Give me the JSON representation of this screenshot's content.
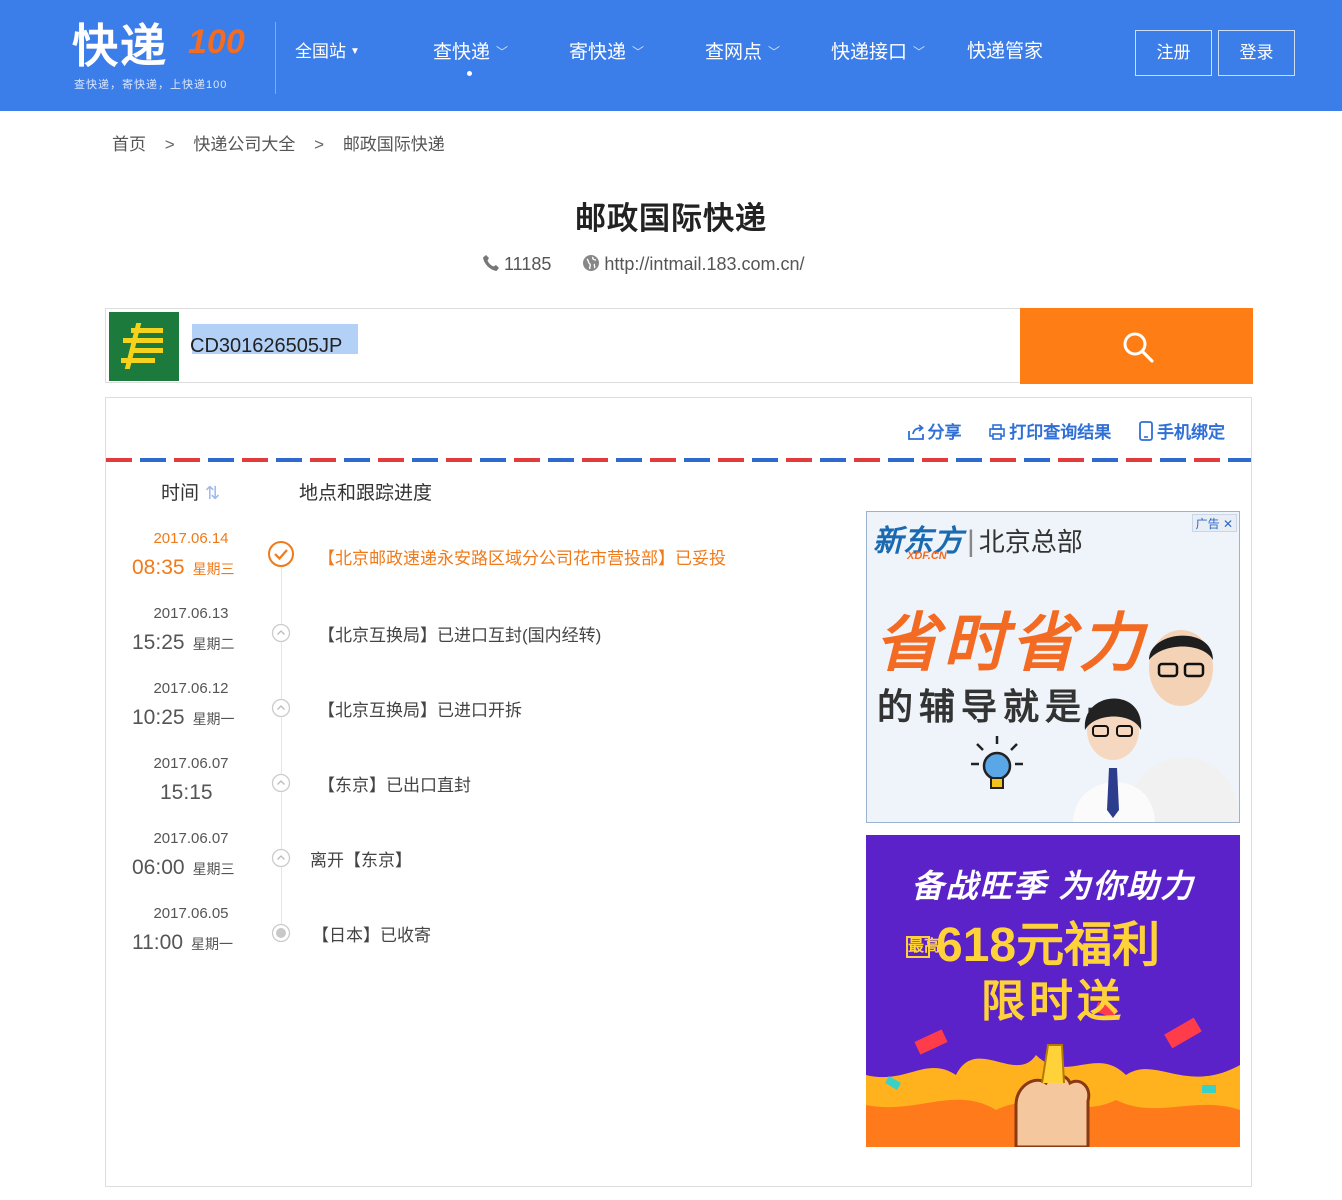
{
  "header": {
    "logo_text": "快递",
    "logo_mark": "100",
    "slogan": "查快递，寄快递，上快递100",
    "region": "全国站",
    "nav": [
      {
        "label": "查快递",
        "has_menu": true,
        "active": true
      },
      {
        "label": "寄快递",
        "has_menu": true,
        "active": false
      },
      {
        "label": "查网点",
        "has_menu": true,
        "active": false
      },
      {
        "label": "快递接口",
        "has_menu": true,
        "active": false
      },
      {
        "label": "快递管家",
        "has_menu": false,
        "active": false
      }
    ],
    "register": "注册",
    "login": "登录"
  },
  "breadcrumb": [
    "首页",
    "快递公司大全",
    "邮政国际快递"
  ],
  "breadcrumb_sep": ">",
  "company": {
    "name": "邮政国际快递",
    "phone": "11185",
    "website": "http://intmail.183.com.cn/"
  },
  "search": {
    "tracking_number": "CD301626505JP"
  },
  "actions": {
    "share": "分享",
    "print": "打印查询结果",
    "bind_phone": "手机绑定"
  },
  "columns": {
    "time": "时间",
    "progress": "地点和跟踪进度"
  },
  "events": [
    {
      "date": "2017.06.14",
      "time": "08:35",
      "weekday": "星期三",
      "desc": "【北京邮政速递永安路区域分公司花市营投部】已妥投"
    },
    {
      "date": "2017.06.13",
      "time": "15:25",
      "weekday": "星期二",
      "desc": "【北京互换局】已进口互封(国内经转)"
    },
    {
      "date": "2017.06.12",
      "time": "10:25",
      "weekday": "星期一",
      "desc": "【北京互换局】已进口开拆"
    },
    {
      "date": "2017.06.07",
      "time": "15:15",
      "weekday": "",
      "desc": "【东京】已出口直封"
    },
    {
      "date": "2017.06.07",
      "time": "06:00",
      "weekday": "星期三",
      "desc": "离开【东京】"
    },
    {
      "date": "2017.06.05",
      "time": "11:00",
      "weekday": "星期一",
      "desc": "【日本】已收寄"
    }
  ],
  "ads": {
    "badge": "广告",
    "ad1": {
      "brand": "新东方",
      "brand_sub": "XDF.CN",
      "location": "北京总部",
      "slogan": "省时省力",
      "sub": "的辅导就是-"
    },
    "ad2": {
      "line1": "备战旺季 为你助力",
      "tag": "最高",
      "line2": "618元福利",
      "line3": "限时送"
    }
  },
  "colors": {
    "header_bg": "#3b7de9",
    "search_button": "#fe7e15",
    "latest_event": "#f07a1a",
    "action_link": "#2f6fd6"
  }
}
